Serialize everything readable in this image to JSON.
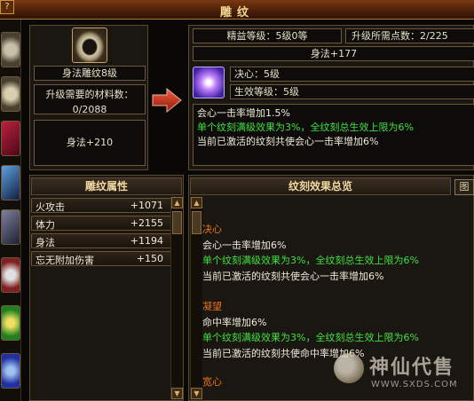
{
  "window": {
    "title": "雕纹",
    "corner_label": "?"
  },
  "item": {
    "name": "身法雕纹8级",
    "materials_label": "升级需要的材料数：",
    "materials_value": "0/2088",
    "bonus": "身法+210"
  },
  "info": {
    "level_text": "精益等级：5级0等",
    "points_text": "升级所需点数：2/225",
    "stat_text": "身法+177",
    "skill_name": "决心：5级",
    "effect_level": "生效等级：5级",
    "desc_line1": "会心一击率增加1.5%",
    "desc_line2": "单个纹刻满级效果为3%，全纹刻总生效上限为6%",
    "desc_line3": "当前已激活的纹刻共使会心一击率增加6%"
  },
  "attributes": {
    "header": "雕纹属性",
    "rows": [
      {
        "name": "火攻击",
        "value": "+1071"
      },
      {
        "name": "体力",
        "value": "+2155"
      },
      {
        "name": "身法",
        "value": "+1194"
      },
      {
        "name": "忘无附加伤害",
        "value": "+150"
      }
    ]
  },
  "overview": {
    "header": "纹刻效果总览",
    "side_button": "图",
    "sections": [
      {
        "title": "决心",
        "line1": "会心一击率增加6%",
        "line2": "单个纹刻满级效果为3%，全纹刻总生效上限为6%",
        "line3": "当前已激活的纹刻共使会心一击率增加6%"
      },
      {
        "title": "凝望",
        "line1": "命中率增加6%",
        "line2": "单个纹刻满级效果为3%，全纹刻总生效上限为6%",
        "line3": "当前已激活的纹刻共使命中率增加6%"
      }
    ],
    "cut_title": "宽心"
  },
  "watermark": {
    "brand": "神仙代售",
    "url": "WWW.SXDS.COM"
  },
  "colors": {
    "green_text": "#40e040",
    "orange_title": "#e87020",
    "gold_header": "#f0d8a0"
  }
}
